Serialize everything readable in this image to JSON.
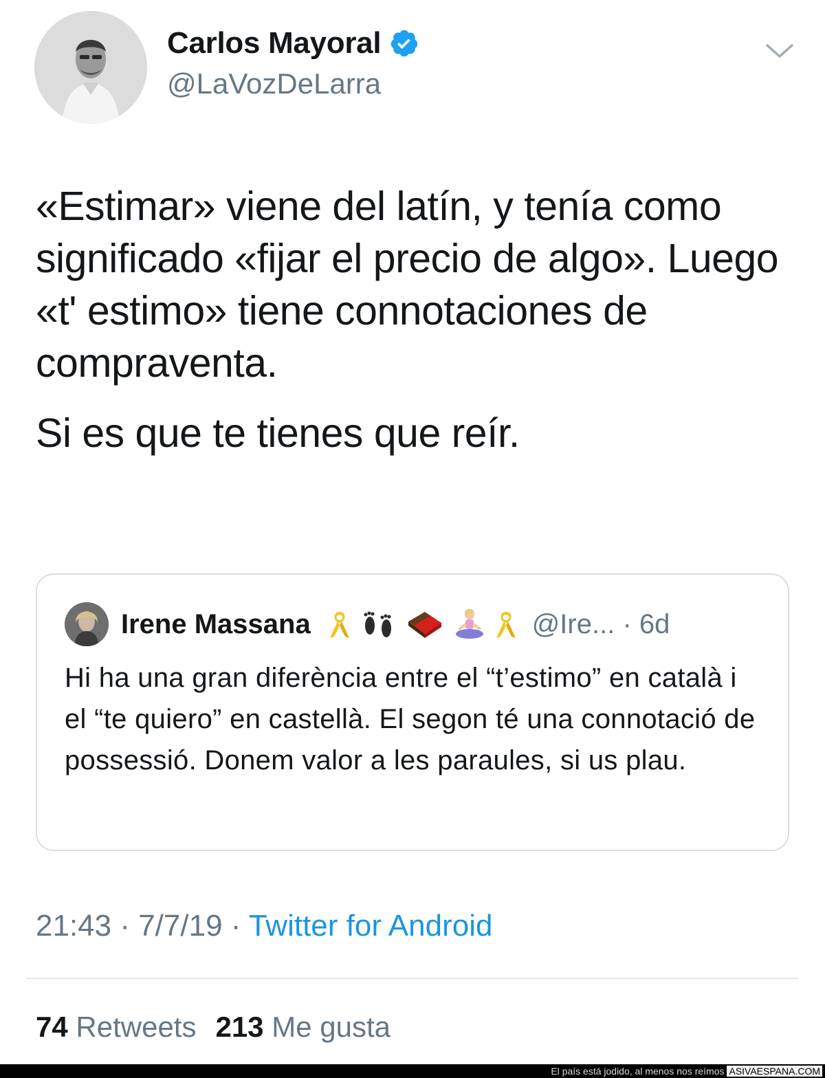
{
  "author": {
    "display_name": "Carlos Mayoral",
    "handle": "@LaVozDeLarra",
    "verified": true,
    "verified_color": "#1da1f2",
    "avatar_icon": "profile-photo"
  },
  "tweet": {
    "paragraphs": [
      "«Estimar» viene del latín, y tenía como significado «fijar el precio de algo». Luego «t' estimo» tiene connotaciones de compraventa.",
      "Si es que te tienes que reír."
    ]
  },
  "quoted_tweet": {
    "display_name": "Irene Massana",
    "emoji_icons": [
      "yellow-ribbon",
      "footprints",
      "chocolate-bar",
      "person-in-lotus-position",
      "yellow-ribbon"
    ],
    "handle_time": "@Ire... · 6d",
    "text": "Hi ha una gran diferència entre el “t’estimo” en català i el “te quiero” en castellà. El segon té una connotació de possessió. Donem valor a les paraules, si us plau."
  },
  "meta": {
    "timestamp": "21:43 · 7/7/19 · ",
    "source": "Twitter for Android",
    "source_color": "#1b95e0"
  },
  "stats": {
    "retweets_count": "74",
    "retweets_label": "Retweets",
    "likes_count": "213",
    "likes_label": "Me gusta"
  },
  "footer": {
    "caption": "El país está jodido, al menos nos reímos",
    "site": "ASIVAESPANA.COM"
  }
}
